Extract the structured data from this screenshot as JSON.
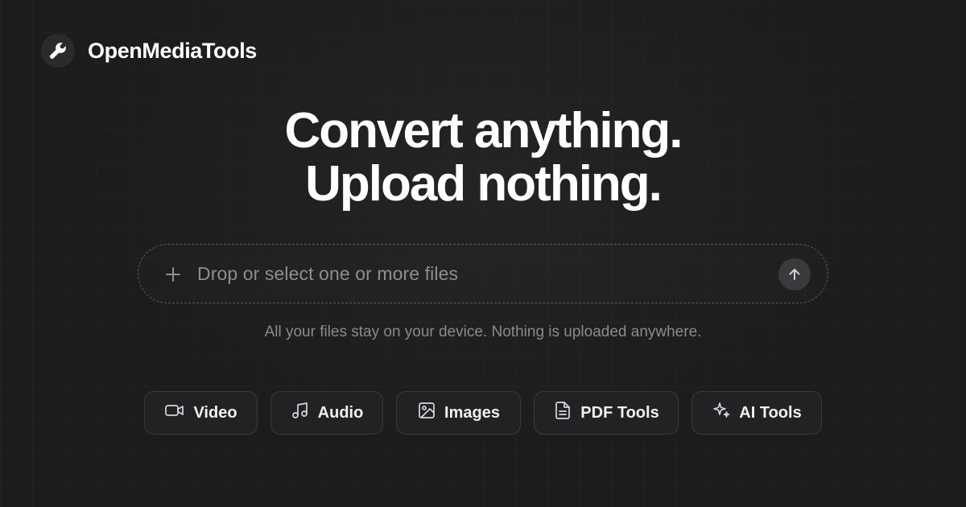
{
  "brand": {
    "name": "OpenMediaTools",
    "icon": "wrench-icon"
  },
  "hero": {
    "line1": "Convert anything.",
    "line2": "Upload nothing."
  },
  "dropzone": {
    "placeholder": "Drop or select one or more files",
    "plus_icon": "plus-icon",
    "upload_icon": "arrow-up-icon"
  },
  "privacy_note": "All your files stay on your device. Nothing is uploaded anywhere.",
  "categories": [
    {
      "label": "Video",
      "icon": "video-camera-icon"
    },
    {
      "label": "Audio",
      "icon": "music-note-icon"
    },
    {
      "label": "Images",
      "icon": "image-icon"
    },
    {
      "label": "PDF Tools",
      "icon": "document-icon"
    },
    {
      "label": "AI Tools",
      "icon": "sparkles-icon"
    }
  ],
  "colors": {
    "background": "#1c1c1c",
    "card": "#222224",
    "border": "#3a3a3c",
    "muted_text": "#8a8a8f",
    "text": "#ffffff"
  }
}
